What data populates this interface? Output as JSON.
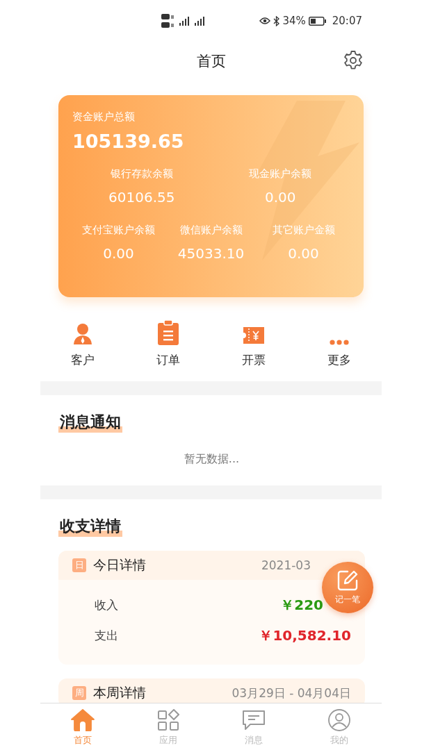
{
  "status_bar": {
    "battery_text": "34%",
    "time": "20:07"
  },
  "header": {
    "title": "首页"
  },
  "balance_card": {
    "label": "资金账户总额",
    "total": "105139.65",
    "accounts_row1": [
      {
        "label": "银行存款余额",
        "value": "60106.55"
      },
      {
        "label": "现金账户余额",
        "value": "0.00"
      }
    ],
    "accounts_row2": [
      {
        "label": "支付宝账户余额",
        "value": "0.00"
      },
      {
        "label": "微信账户余额",
        "value": "45033.10"
      },
      {
        "label": "其它账户金额",
        "value": "0.00"
      }
    ]
  },
  "quick_actions": [
    {
      "kind": "person",
      "label": "客户"
    },
    {
      "kind": "clipboard",
      "label": "订单"
    },
    {
      "kind": "ticket",
      "label": "开票"
    },
    {
      "kind": "more",
      "label": "更多"
    }
  ],
  "notifications": {
    "title": "消息通知",
    "empty_text": "暂无数据..."
  },
  "finance": {
    "title": "收支详情",
    "periods": [
      {
        "badge": "日",
        "title": "今日详情",
        "date": "2021-03",
        "rows": [
          {
            "kind": "income",
            "label": "收入",
            "amount": "￥220"
          },
          {
            "kind": "expense",
            "label": "支出",
            "amount": "￥10,582.10"
          }
        ]
      },
      {
        "badge": "周",
        "title": "本周详情",
        "date": "03月29日 - 04月04日"
      }
    ]
  },
  "fab": {
    "label": "记一笔"
  },
  "tab_bar": [
    {
      "kind": "home",
      "label": "首页",
      "selected": true
    },
    {
      "kind": "apps",
      "label": "应用",
      "selected": false
    },
    {
      "kind": "message",
      "label": "消息",
      "selected": false
    },
    {
      "kind": "profile",
      "label": "我的",
      "selected": false
    }
  ]
}
